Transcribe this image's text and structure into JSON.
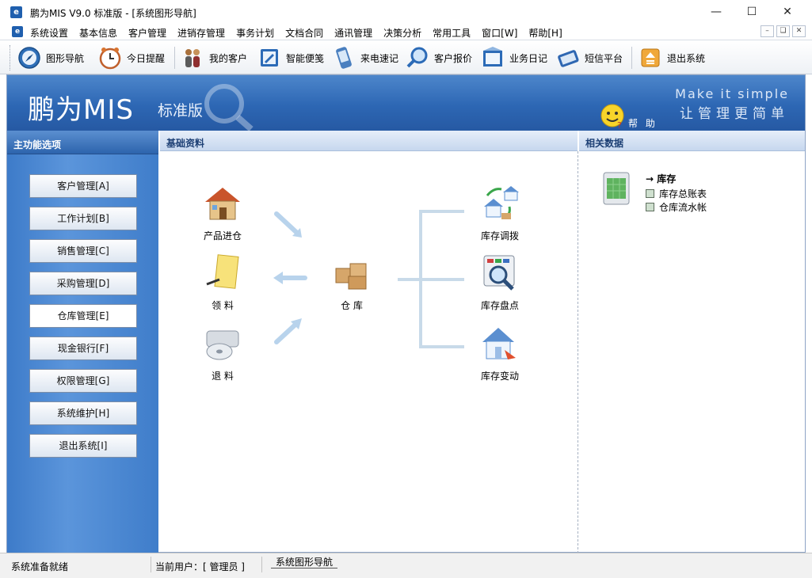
{
  "window": {
    "app_icon": "app-logo-icon",
    "title": "鹏为MIS V9.0 标准版 - [系统图形导航]",
    "controls": [
      "minimize-icon",
      "maximize-icon",
      "close-icon"
    ]
  },
  "menu": {
    "items": [
      "系统设置",
      "基本信息",
      "客户管理",
      "进销存管理",
      "事务计划",
      "文档合同",
      "通讯管理",
      "决策分析",
      "常用工具",
      "窗口[W]",
      "帮助[H]"
    ]
  },
  "toolbar": {
    "items": [
      {
        "label": "图形导航",
        "icon": "compass-icon"
      },
      {
        "label": "今日提醒",
        "icon": "clock-icon"
      },
      {
        "label": "我的客户",
        "icon": "users-icon"
      },
      {
        "label": "智能便笺",
        "icon": "notepad-icon"
      },
      {
        "label": "来电速记",
        "icon": "phone-icon"
      },
      {
        "label": "客户报价",
        "icon": "magnifier-icon"
      },
      {
        "label": "业务日记",
        "icon": "diary-icon"
      },
      {
        "label": "短信平台",
        "icon": "sms-icon"
      },
      {
        "label": "退出系统",
        "icon": "exit-icon"
      }
    ]
  },
  "banner": {
    "brand": "鹏为MIS",
    "edition": "标准版",
    "slogan_en": "Make it simple",
    "slogan_cn": "让管理更简单",
    "help_label": "帮 助"
  },
  "sidebar": {
    "title": "主功能选项",
    "items": [
      "客户管理[A]",
      "工作计划[B]",
      "销售管理[C]",
      "采购管理[D]",
      "仓库管理[E]",
      "现金银行[F]",
      "权限管理[G]",
      "系统维护[H]",
      "退出系统[I]"
    ],
    "active_index": 4
  },
  "center": {
    "title": "基础资料",
    "nodes": {
      "product_in": "产品进仓",
      "requisition": "领  料",
      "return": "退  料",
      "warehouse": "仓  库",
      "transfer": "库存调拨",
      "stocktake": "库存盘点",
      "change": "库存变动"
    }
  },
  "related": {
    "title": "相关数据",
    "heading": "→ 库存",
    "items": [
      "库存总账表",
      "仓库流水帐"
    ]
  },
  "status": {
    "ready": "系统准备就绪",
    "user": "当前用户：[ 管理员 ]",
    "tab": "系统图形导航"
  }
}
